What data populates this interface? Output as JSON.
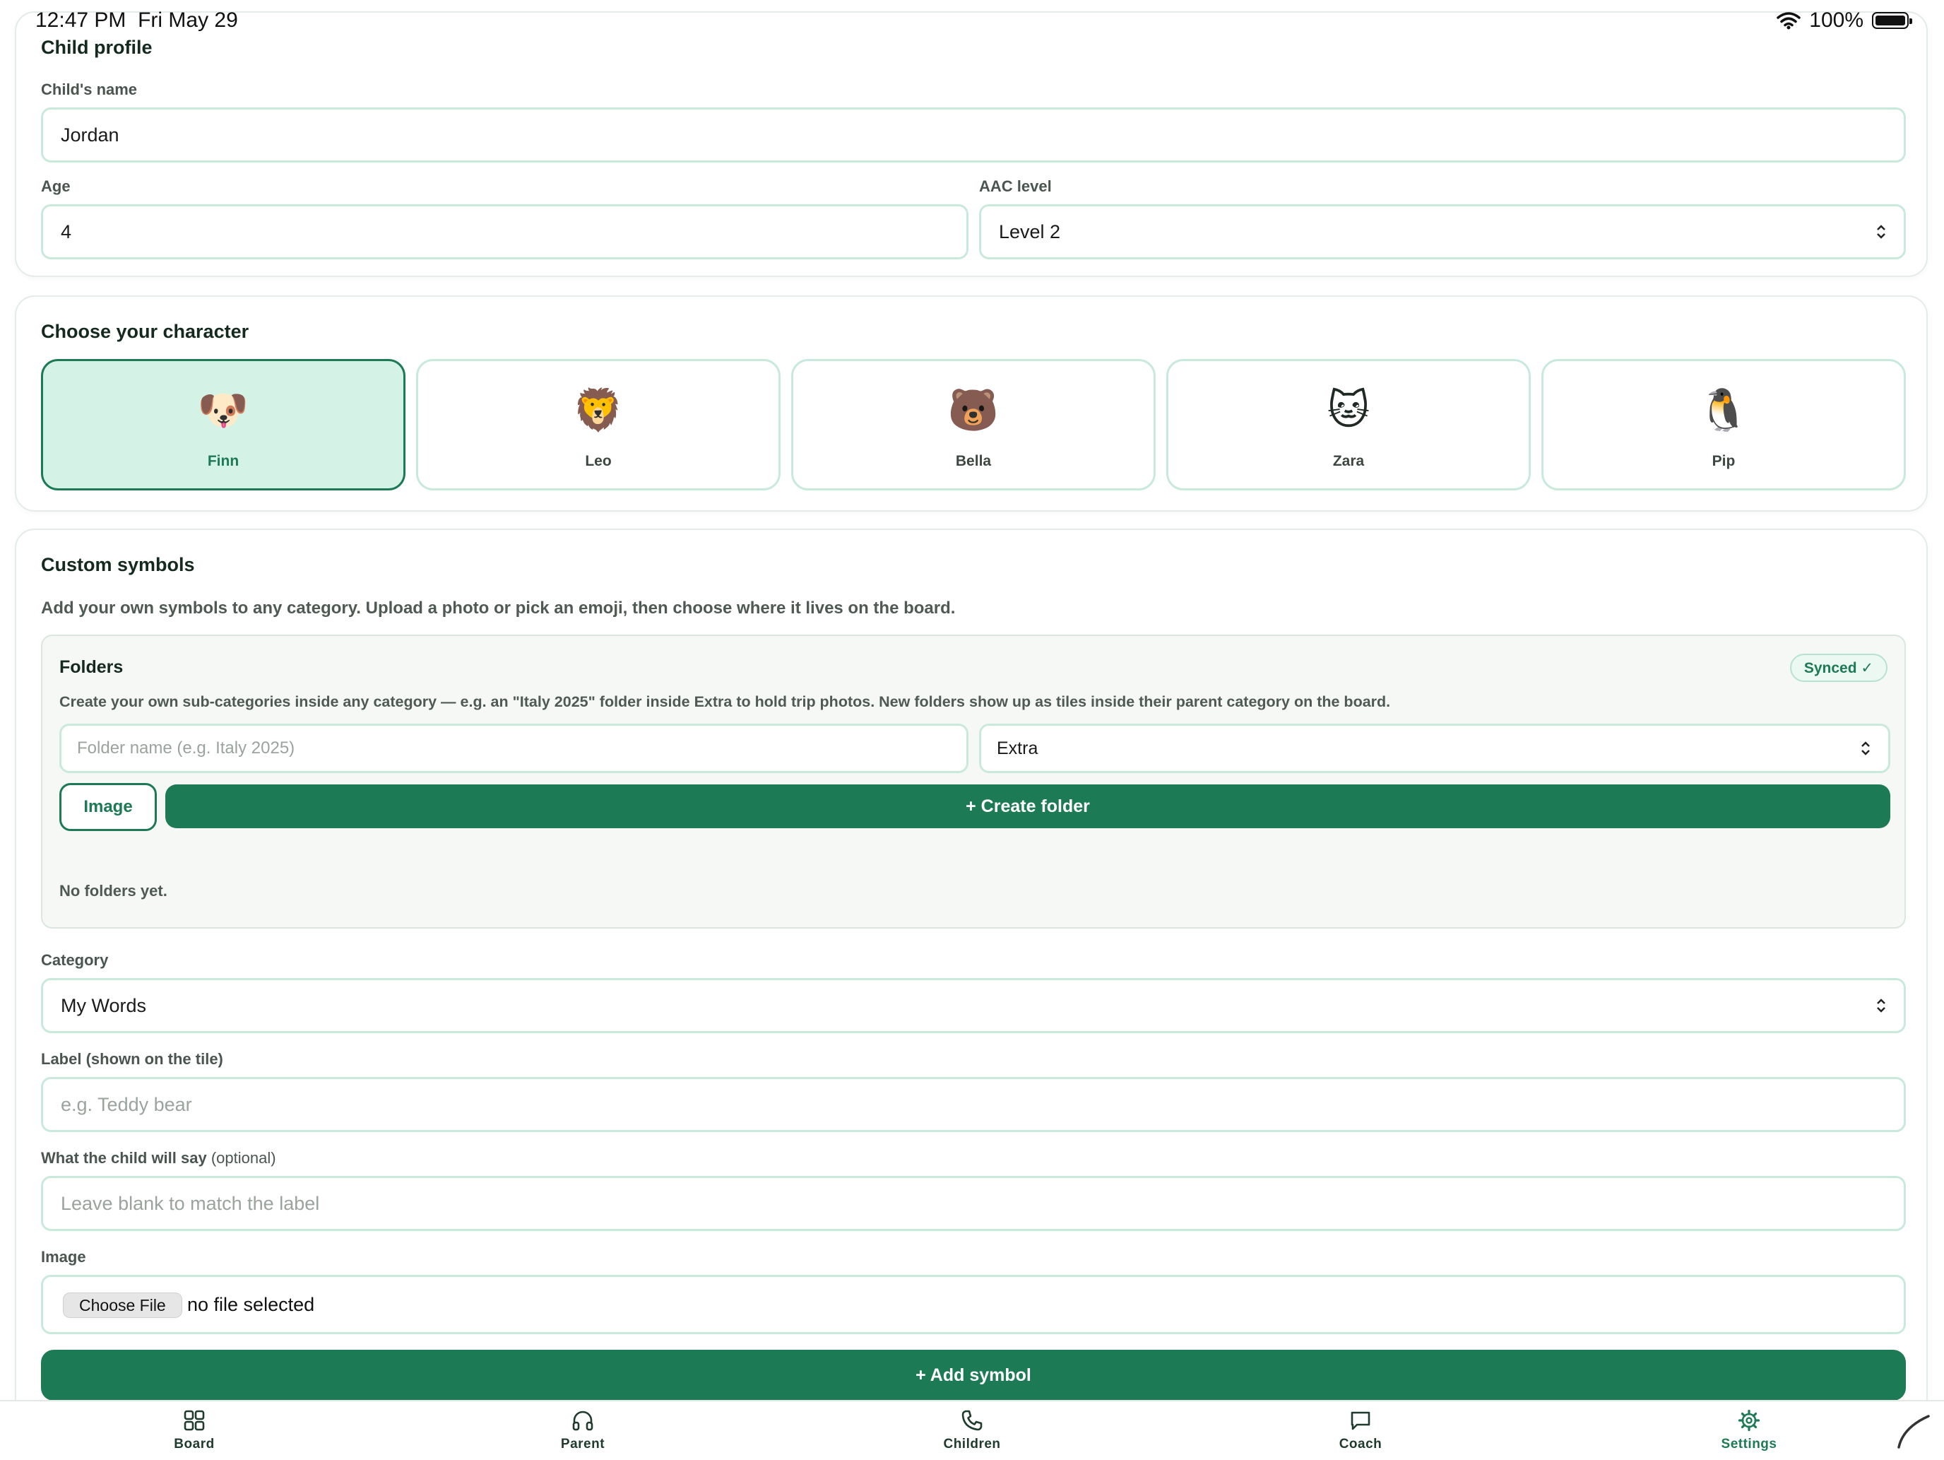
{
  "status_bar": {
    "time": "12:47 PM",
    "date": "Fri May 29",
    "battery": "100%"
  },
  "child_profile": {
    "title": "Child profile",
    "name_label": "Child's name",
    "name_value": "Jordan",
    "age_label": "Age",
    "age_value": "4",
    "aac_label": "AAC level",
    "aac_value": "Level 2"
  },
  "character": {
    "title": "Choose your character",
    "selected": "Finn",
    "options": [
      {
        "name": "Finn",
        "emoji": "🐶"
      },
      {
        "name": "Leo",
        "emoji": "🦁"
      },
      {
        "name": "Bella",
        "emoji": "🐻"
      },
      {
        "name": "Zara",
        "emoji": "🐱"
      },
      {
        "name": "Pip",
        "emoji": "🐧"
      }
    ]
  },
  "custom_symbols": {
    "title": "Custom symbols",
    "description": "Add your own symbols to any category. Upload a photo or pick an emoji, then choose where it lives on the board.",
    "folders": {
      "title": "Folders",
      "badge": "Synced ✓",
      "description": "Create your own sub-categories inside any category — e.g. an \"Italy 2025\" folder inside Extra to hold trip photos. New folders show up as tiles inside their parent category on the board.",
      "name_placeholder": "Folder name (e.g. Italy 2025)",
      "parent_value": "Extra",
      "image_button": "Image",
      "create_button": "+ Create folder",
      "empty_text": "No folders yet."
    },
    "category_label": "Category",
    "category_value": "My Words",
    "label_label": "Label (shown on the tile)",
    "label_placeholder": "e.g. Teddy bear",
    "say_label": "What the child will say",
    "say_optional": "(optional)",
    "say_placeholder": "Leave blank to match the label",
    "image_label": "Image",
    "file_button": "Choose File",
    "file_status": "no file selected",
    "add_button": "+ Add symbol"
  },
  "tabs": [
    {
      "label": "Board",
      "icon": "grid-icon"
    },
    {
      "label": "Parent",
      "icon": "headphones-icon"
    },
    {
      "label": "Children",
      "icon": "phone-icon"
    },
    {
      "label": "Coach",
      "icon": "chat-bubble-icon"
    },
    {
      "label": "Settings",
      "icon": "gear-icon"
    }
  ],
  "active_tab": "Settings",
  "colors": {
    "accent": "#1c7a55",
    "selected_bg": "#d4f3e6",
    "input_border": "#c9e9dc"
  }
}
